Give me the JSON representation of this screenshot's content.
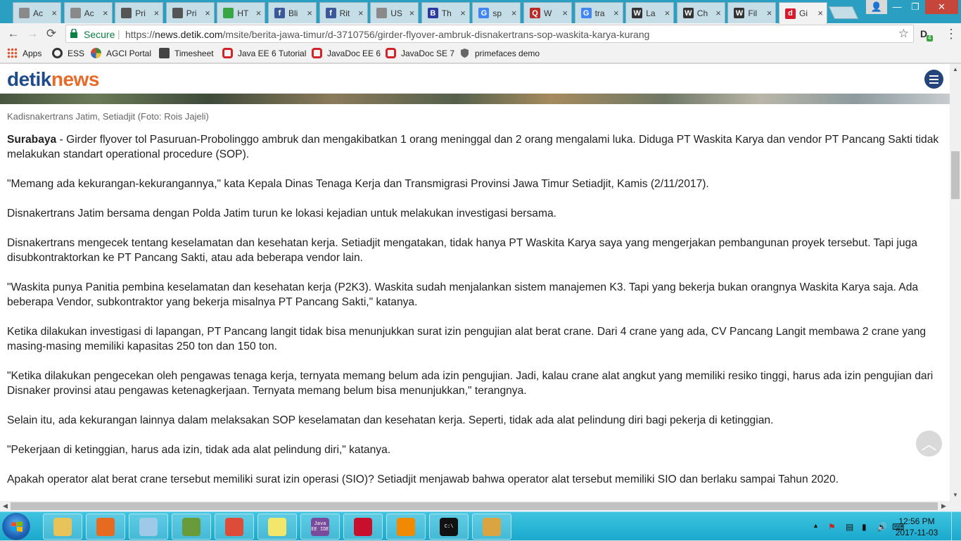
{
  "browser": {
    "tabs": [
      {
        "title": "Ac",
        "icon": "page-icon",
        "color": "#8a8a8a"
      },
      {
        "title": "Ac",
        "icon": "page-icon",
        "color": "#8a8a8a"
      },
      {
        "title": "Pri",
        "icon": "shield-icon",
        "color": "#555555"
      },
      {
        "title": "Pri",
        "icon": "shield-icon",
        "color": "#555555"
      },
      {
        "title": "HT",
        "icon": "chart-icon",
        "color": "#3aa545"
      },
      {
        "title": "Bli",
        "icon": "facebook-icon",
        "color": "#3b5998"
      },
      {
        "title": "Rit",
        "icon": "facebook-icon",
        "color": "#3b5998"
      },
      {
        "title": "US",
        "icon": "page-icon",
        "color": "#8a8a8a"
      },
      {
        "title": "Th",
        "icon": "b-icon",
        "color": "#2b3a9e"
      },
      {
        "title": "sp",
        "icon": "google-icon",
        "color": "#4285f4"
      },
      {
        "title": "W",
        "icon": "quora-icon",
        "color": "#b92b27"
      },
      {
        "title": "tra",
        "icon": "google-icon",
        "color": "#4285f4"
      },
      {
        "title": "La",
        "icon": "wikipedia-icon",
        "color": "#333333"
      },
      {
        "title": "Ch",
        "icon": "wikipedia-icon",
        "color": "#333333"
      },
      {
        "title": "Fil",
        "icon": "wikipedia-icon",
        "color": "#333333"
      },
      {
        "title": "Gi",
        "icon": "detik-icon",
        "color": "#d81b2c"
      }
    ],
    "tab_glyphs": [
      "",
      "",
      "",
      "",
      "",
      "f",
      "f",
      "",
      "B",
      "G",
      "Q",
      "G",
      "W",
      "W",
      "W",
      "d"
    ],
    "close_glyph": "×",
    "nav": {
      "back": "←",
      "forward": "→",
      "reload": "⟳"
    },
    "omnibox": {
      "secure_label": "Secure",
      "scheme": "https://",
      "host": "news.detik.com",
      "path": "/msite/berita-jawa-timur/d-3710756/girder-flyover-ambruk-disnakertrans-sop-waskita-karya-kurang",
      "star": "☆"
    },
    "extension_badge": "4",
    "menu": "⋮",
    "window_controls": {
      "user": "👤",
      "minimize": "—",
      "restore": "❐",
      "close": "✕"
    }
  },
  "bookmarks": [
    {
      "label": "Apps",
      "icon": "apps-grid-icon",
      "color": "#e0552f"
    },
    {
      "label": "ESS",
      "icon": "circle-icon",
      "color": "#333333"
    },
    {
      "label": "AGCI Portal",
      "icon": "agci-icon",
      "color": "#3a8a3a"
    },
    {
      "label": "Timesheet",
      "icon": "timesheet-icon",
      "color": "#444444"
    },
    {
      "label": "Java EE 6 Tutorial",
      "icon": "oracle-icon",
      "color": "#d0232a"
    },
    {
      "label": "JavaDoc EE 6",
      "icon": "oracle-icon",
      "color": "#d0232a"
    },
    {
      "label": "JavaDoc SE 7",
      "icon": "oracle-icon",
      "color": "#d0232a"
    },
    {
      "label": "primefaces demo",
      "icon": "shield-icon",
      "color": "#555555"
    }
  ],
  "site": {
    "logo_part1": "detik",
    "logo_part2": "news",
    "caption": "Kadisnakertrans Jatim, Setiadjit (Foto: Rois Jajeli)",
    "lead_location": "Surabaya",
    "paragraphs": [
      " - Girder flyover tol Pasuruan-Probolinggo ambruk dan mengakibatkan 1 orang meninggal dan 2 orang mengalami luka. Diduga PT Waskita Karya dan vendor PT Pancang Sakti tidak melakukan standart operational procedure (SOP).",
      "\"Memang ada kekurangan-kekurangannya,\" kata Kepala Dinas Tenaga Kerja dan Transmigrasi Provinsi Jawa Timur Setiadjit, Kamis (2/11/2017).",
      "Disnakertrans Jatim bersama dengan Polda Jatim turun ke lokasi kejadian untuk melakukan investigasi bersama.",
      "Disnakertrans mengecek tentang keselamatan dan kesehatan kerja. Setiadjit mengatakan, tidak hanya PT Waskita Karya saya yang mengerjakan pembangunan proyek tersebut. Tapi juga disubkontraktorkan ke PT Pancang Sakti, atau ada beberapa vendor lain.",
      "\"Waskita punya Panitia pembina keselamatan dan kesehatan kerja (P2K3). Waskita sudah menjalankan sistem manajemen K3. Tapi yang bekerja bukan orangnya Waskita Karya saja. Ada beberapa Vendor, subkontraktor yang bekerja misalnya PT Pancang Sakti,\" katanya.",
      "Ketika dilakukan investigasi di lapangan, PT Pancang langit tidak bisa menunjukkan surat izin pengujian alat berat crane. Dari 4 crane yang ada, CV Pancang Langit membawa 2 crane yang masing-masing memiliki kapasitas 250 ton dan 150 ton.",
      "\"Ketika dilakukan pengecekan oleh pengawas tenaga kerja, ternyata memang belum ada izin pengujian. Jadi, kalau crane alat angkut yang memiliki resiko tinggi, harus ada izin pengujian dari Disnaker provinsi atau pengawas ketenagkerjaan. Ternyata memang belum bisa menunjukkan,\" terangnya.",
      "Selain itu, ada kekurangan lainnya dalam melaksakan SOP keselamatan dan kesehatan kerja. Seperti, tidak ada alat pelindung diri bagi pekerja di ketinggian.",
      "\"Pekerjaan di ketinggian, harus ada izin, tidak ada alat pelindung diri,\" katanya.",
      "Apakah operator alat berat crane tersebut memiliki surat izin operasi (SIO)? Setiadjit menjawab bahwa operator alat tersebut memiliki SIO dan berlaku sampai Tahun 2020."
    ],
    "scroll_top_glyph": "︿"
  },
  "taskbar": {
    "apps": [
      {
        "name": "explorer-icon",
        "color": "#e8c35a"
      },
      {
        "name": "firefox-icon",
        "color": "#e66a1f"
      },
      {
        "name": "notepad-icon",
        "color": "#9fc9e8"
      },
      {
        "name": "chart-app-icon",
        "color": "#6a9b3a"
      },
      {
        "name": "chrome-icon",
        "color": "#dd4b39"
      },
      {
        "name": "sticky-notes-icon",
        "color": "#f3e76b"
      },
      {
        "name": "java-ee-ide-icon",
        "color": "#7a4a9b"
      },
      {
        "name": "acrobat-icon",
        "color": "#c8102e"
      },
      {
        "name": "vlc-icon",
        "color": "#f08a00"
      },
      {
        "name": "cmd-icon",
        "color": "#111111"
      },
      {
        "name": "paint-icon",
        "color": "#d9a441"
      }
    ],
    "app_glyphs": [
      "",
      "",
      "",
      "",
      "",
      "",
      "Java EE IDE",
      "",
      "",
      "C:\\",
      ""
    ],
    "tray_glyphs": {
      "show_hidden": "▲",
      "flag": "⚑",
      "network": "▤",
      "battery": "▮",
      "volume": "🔊",
      "ime": "⌨"
    },
    "time": "12:56 PM",
    "date": "2017-11-03"
  }
}
